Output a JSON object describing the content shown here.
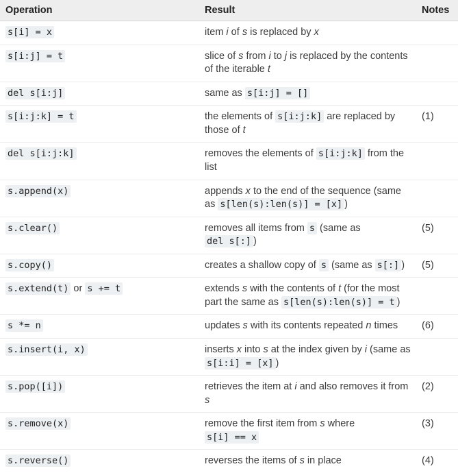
{
  "headers": {
    "operation": "Operation",
    "result": "Result",
    "notes": "Notes"
  },
  "rows": [
    {
      "operation_segments": [
        {
          "code": "s[i] = x"
        }
      ],
      "result_segments": [
        {
          "text": "item "
        },
        {
          "em": "i"
        },
        {
          "text": " of "
        },
        {
          "em": "s"
        },
        {
          "text": " is replaced by "
        },
        {
          "em": "x"
        }
      ],
      "notes": ""
    },
    {
      "operation_segments": [
        {
          "code": "s[i:j] = t"
        }
      ],
      "result_segments": [
        {
          "text": "slice of "
        },
        {
          "em": "s"
        },
        {
          "text": " from "
        },
        {
          "em": "i"
        },
        {
          "text": " to "
        },
        {
          "em": "j"
        },
        {
          "text": " is replaced by the contents of the iterable "
        },
        {
          "em": "t"
        }
      ],
      "notes": ""
    },
    {
      "operation_segments": [
        {
          "code": "del s[i:j]"
        }
      ],
      "result_segments": [
        {
          "text": "same as "
        },
        {
          "code": "s[i:j] = []"
        }
      ],
      "notes": ""
    },
    {
      "operation_segments": [
        {
          "code": "s[i:j:k] = t"
        }
      ],
      "result_segments": [
        {
          "text": "the elements of "
        },
        {
          "code": "s[i:j:k]"
        },
        {
          "text": " are replaced by those of "
        },
        {
          "em": "t"
        }
      ],
      "notes": "(1)"
    },
    {
      "operation_segments": [
        {
          "code": "del s[i:j:k]"
        }
      ],
      "result_segments": [
        {
          "text": "removes the elements of "
        },
        {
          "code": "s[i:j:k]"
        },
        {
          "text": " from the list"
        }
      ],
      "notes": ""
    },
    {
      "operation_segments": [
        {
          "code": "s.append(x)"
        }
      ],
      "result_segments": [
        {
          "text": "appends "
        },
        {
          "em": "x"
        },
        {
          "text": " to the end of the sequence (same as "
        },
        {
          "code": "s[len(s):len(s)] = [x]"
        },
        {
          "text": ")"
        }
      ],
      "notes": ""
    },
    {
      "operation_segments": [
        {
          "code": "s.clear()"
        }
      ],
      "result_segments": [
        {
          "text": "removes all items from "
        },
        {
          "code": "s"
        },
        {
          "text": " (same as "
        },
        {
          "code": "del s[:]"
        },
        {
          "text": ")"
        }
      ],
      "notes": "(5)"
    },
    {
      "operation_segments": [
        {
          "code": "s.copy()"
        }
      ],
      "result_segments": [
        {
          "text": "creates a shallow copy of "
        },
        {
          "code": "s"
        },
        {
          "text": " (same as "
        },
        {
          "code": "s[:]"
        },
        {
          "text": ")"
        }
      ],
      "notes": "(5)"
    },
    {
      "operation_segments": [
        {
          "code": "s.extend(t)"
        },
        {
          "text": " or "
        },
        {
          "code": "s += t"
        }
      ],
      "result_segments": [
        {
          "text": "extends "
        },
        {
          "em": "s"
        },
        {
          "text": " with the contents of "
        },
        {
          "em": "t"
        },
        {
          "text": " (for the most part the same as "
        },
        {
          "code": "s[len(s):len(s)] = t"
        },
        {
          "text": ")"
        }
      ],
      "notes": ""
    },
    {
      "operation_segments": [
        {
          "code": "s *= n"
        }
      ],
      "result_segments": [
        {
          "text": "updates "
        },
        {
          "em": "s"
        },
        {
          "text": " with its contents repeated "
        },
        {
          "em": "n"
        },
        {
          "text": " times"
        }
      ],
      "notes": "(6)"
    },
    {
      "operation_segments": [
        {
          "code": "s.insert(i, x)"
        }
      ],
      "result_segments": [
        {
          "text": "inserts "
        },
        {
          "em": "x"
        },
        {
          "text": " into "
        },
        {
          "em": "s"
        },
        {
          "text": " at the index given by "
        },
        {
          "em": "i"
        },
        {
          "text": " (same as "
        },
        {
          "code": "s[i:i] = [x]"
        },
        {
          "text": ")"
        }
      ],
      "notes": ""
    },
    {
      "operation_segments": [
        {
          "code": "s.pop([i])"
        }
      ],
      "result_segments": [
        {
          "text": "retrieves the item at "
        },
        {
          "em": "i"
        },
        {
          "text": " and also removes it from "
        },
        {
          "em": "s"
        }
      ],
      "notes": "(2)"
    },
    {
      "operation_segments": [
        {
          "code": "s.remove(x)"
        }
      ],
      "result_segments": [
        {
          "text": "remove the first item from "
        },
        {
          "em": "s"
        },
        {
          "text": " where "
        },
        {
          "code": "s[i] == x"
        }
      ],
      "notes": "(3)"
    },
    {
      "operation_segments": [
        {
          "code": "s.reverse()"
        }
      ],
      "result_segments": [
        {
          "text": "reverses the items of "
        },
        {
          "em": "s"
        },
        {
          "text": " in place"
        }
      ],
      "notes": "(4)"
    }
  ]
}
